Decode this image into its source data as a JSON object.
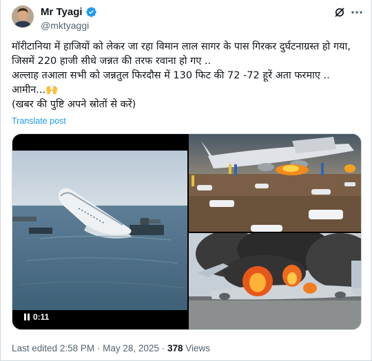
{
  "author": {
    "display_name": "Mr Tyagi",
    "handle": "@mktyaggi",
    "verified": true,
    "avatar": "profile-photo"
  },
  "icons": {
    "verified": "verified-badge-icon",
    "grok": "grok-icon",
    "more": "more-options-icon",
    "pause": "pause-icon"
  },
  "tweet": {
    "lines": [
      "मॉरीटानिया में हाजियों को लेकर जा रहा विमान लाल सागर के पास गिरकर दुर्घटनाग्रस्त हो गया, जिसमें 220 हाजी सीधे जन्नत की तरफ रवाना हो गए ..",
      "अल्लाह तआला सभी को जन्नतुल फिरदौस में 130 फिट की 72 -72 हूरें अता फरमाए ..",
      "आमीन...🙌",
      "(खबर की पुष्टि अपने स्रोतों से करें)"
    ],
    "translate_label": "Translate post"
  },
  "media": {
    "video_time": "0:11",
    "video_image": "plane-sinking-in-sea",
    "photo_top": "crashed-plane-on-ground-with-covered-bodies",
    "photo_bottom": "burning-plane-on-runway"
  },
  "meta": {
    "edited_label": "Last edited",
    "time": "2:58 PM",
    "separator": "·",
    "date": "May 28, 2025",
    "views_count": "378",
    "views_label": "Views"
  },
  "colors": {
    "link": "#1d9bf0",
    "secondary_text": "#536471",
    "border": "#cfd9de"
  }
}
